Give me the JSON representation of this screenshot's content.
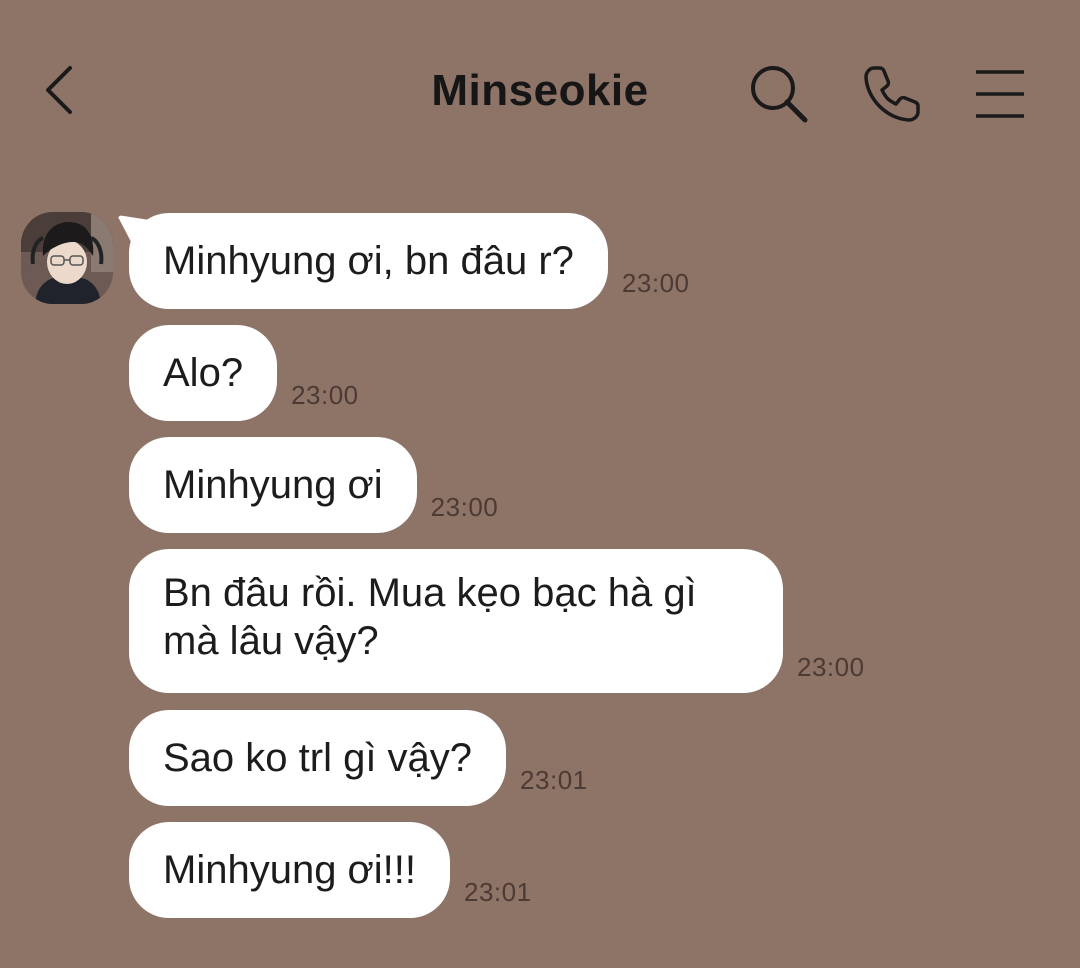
{
  "header": {
    "title": "Minseokie",
    "back_icon": "chevron-left-icon",
    "search_icon": "search-icon",
    "call_icon": "phone-icon",
    "menu_icon": "menu-icon"
  },
  "contact": {
    "avatar": "contact-avatar"
  },
  "messages": [
    {
      "text": "Minhyung ơi, bn đâu r?",
      "time": "23:00"
    },
    {
      "text": "Alo?",
      "time": "23:00"
    },
    {
      "text": "Minhyung ơi",
      "time": "23:00"
    },
    {
      "text": "Bn đâu rồi. Mua kẹo bạc hà gì mà lâu vậy?",
      "time": "23:00"
    },
    {
      "text": "Sao ko trl gì vậy?",
      "time": "23:01"
    },
    {
      "text": "Minhyung ơi!!!",
      "time": "23:01"
    }
  ],
  "colors": {
    "background": "#8E7367",
    "bubble": "#FFFFFF",
    "timestamp": "#4C3B35"
  }
}
